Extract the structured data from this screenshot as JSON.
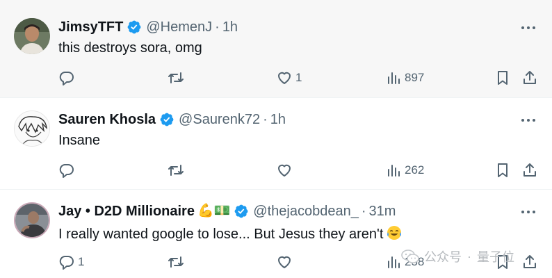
{
  "tweets": [
    {
      "name": "JimsyTFT",
      "handle": "@HemenJ",
      "separator": "·",
      "time": "1h",
      "text": "this destroys sora, omg",
      "replies": "",
      "retweets": "",
      "likes": "1",
      "views": "897",
      "avatar": "person-photo"
    },
    {
      "name": "Sauren Khosla",
      "handle": "@Saurenk72",
      "separator": "·",
      "time": "1h",
      "text": "Insane",
      "replies": "",
      "retweets": "",
      "likes": "",
      "views": "262",
      "avatar": "manga-sketch"
    },
    {
      "name": "Jay • D2D Millionaire",
      "name_emojis": "💪💵",
      "handle": "@thejacobdean_",
      "separator": "·",
      "time": "31m",
      "text": "I really wanted google to lose... But Jesus they aren't",
      "text_emoji": "joy-tears-emoji",
      "replies": "1",
      "retweets": "",
      "likes": "",
      "views": "258",
      "avatar": "gym-photo"
    }
  ],
  "watermark": {
    "icon": "wechat-icon",
    "label": "公众号",
    "separator": "·",
    "brand": "量子位"
  },
  "colors": {
    "verified": "#1d9bf0",
    "secondary_text": "#536471",
    "primary_text": "#0f1419",
    "highlight_bg": "#f7f7f7"
  }
}
